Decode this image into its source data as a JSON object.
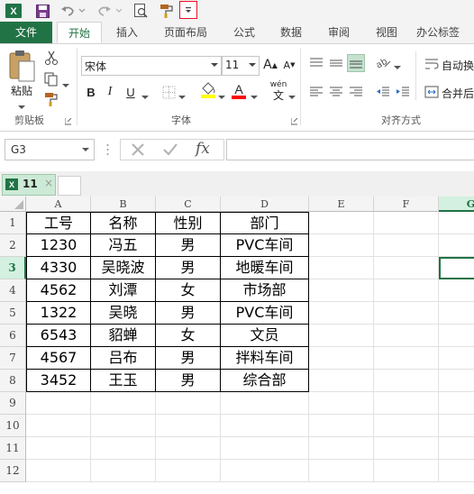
{
  "qat": {
    "excel_logo": "X",
    "save_icon": "save-icon",
    "undo_icon": "undo-icon",
    "redo_icon": "redo-icon",
    "preview_icon": "print-preview-icon",
    "brush_icon": "format-painter-icon",
    "customize_icon": "customize-dropdown-icon"
  },
  "tabs": {
    "file": "文件",
    "home": "开始",
    "insert": "插入",
    "layout": "页面布局",
    "formulas": "公式",
    "data": "数据",
    "review": "审阅",
    "view": "视图",
    "office": "办公标签"
  },
  "ribbon": {
    "paste": "粘贴",
    "clipboard": "剪贴板",
    "font_name": "宋体",
    "font_size": "11",
    "font_group": "字体",
    "bold": "B",
    "italic": "I",
    "underline": "U",
    "wen": "wén",
    "wen_char": "文",
    "font_color_a": "A",
    "grow_a": "A",
    "shrink_a": "A",
    "wrap_text": "自动换",
    "merge": "合并后",
    "alignment_group": "对齐方式"
  },
  "formula_bar": {
    "name_box": "G3",
    "fx": "fx",
    "formula": ""
  },
  "workbook_tabs": {
    "book_name": "11",
    "close": "×"
  },
  "sheet": {
    "columns": [
      "A",
      "B",
      "C",
      "D",
      "E",
      "F",
      "G"
    ],
    "rows": [
      "1",
      "2",
      "3",
      "4",
      "5",
      "6",
      "7",
      "8",
      "9",
      "10",
      "11",
      "12"
    ],
    "headers": [
      "工号",
      "名称",
      "性别",
      "部门"
    ],
    "records": [
      [
        "1230",
        "冯五",
        "男",
        "PVC车间"
      ],
      [
        "4330",
        "吴晓波",
        "男",
        "地暖车间"
      ],
      [
        "4562",
        "刘潭",
        "女",
        "市场部"
      ],
      [
        "1322",
        "吴晓",
        "男",
        "PVC车间"
      ],
      [
        "6543",
        "貂蝉",
        "女",
        "文员"
      ],
      [
        "4567",
        "吕布",
        "男",
        "拌料车间"
      ],
      [
        "3452",
        "王玉",
        "男",
        "综合部"
      ]
    ]
  },
  "colors": {
    "accent": "#217346",
    "highlight": "#e81123",
    "fill_yellow": "#ffff00",
    "font_red": "#ff0000"
  }
}
